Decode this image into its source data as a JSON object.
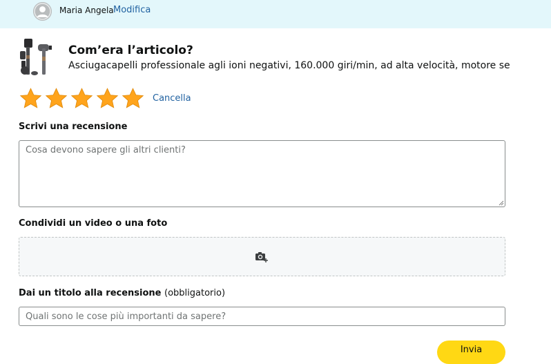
{
  "header": {
    "user_name": "Maria Angela",
    "edit_label": "Modifica"
  },
  "product": {
    "question": "Com’era l’articolo?",
    "description": "Asciugacapelli professionale agli ioni negativi, 160.000 giri/min, ad alta velocità, motore senza …"
  },
  "rating": {
    "stars_selected": 5,
    "stars_total": 5,
    "star_color": "#ffa41c",
    "clear_label": "Cancella"
  },
  "review": {
    "label": "Scrivi una recensione",
    "placeholder": "Cosa devono sapere gli altri clienti?"
  },
  "media": {
    "label": "Condividi un video o una foto",
    "icon": "camera-add-icon"
  },
  "review_title": {
    "label": "Dai un titolo alla recensione",
    "required_note": "(obbligatorio)",
    "placeholder": "Quali sono le cose più importanti da sapere?"
  },
  "submit": {
    "label": "Invia",
    "color": "#ffd814"
  },
  "colors": {
    "link": "#2162a1",
    "header_bg": "#e3f7fb"
  }
}
